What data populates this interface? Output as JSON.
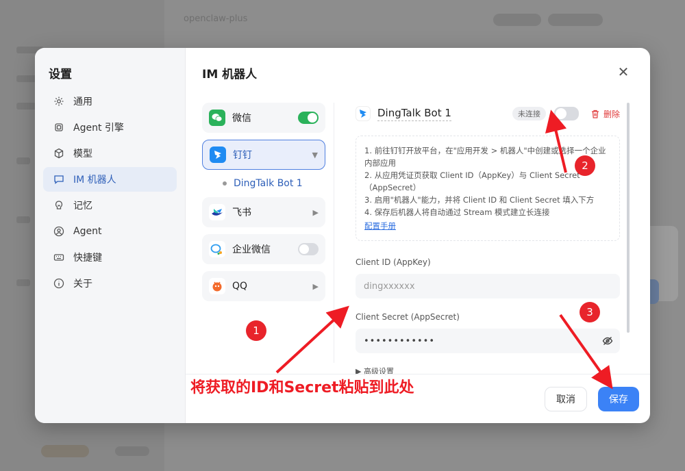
{
  "background": {
    "title": "openclaw-plus"
  },
  "nav": {
    "title": "设置",
    "items": [
      {
        "label": "通用",
        "icon": "gear-icon"
      },
      {
        "label": "Agent 引擎",
        "icon": "chip-icon"
      },
      {
        "label": "模型",
        "icon": "cube-icon"
      },
      {
        "label": "IM 机器人",
        "icon": "chat-icon",
        "active": true
      },
      {
        "label": "记忆",
        "icon": "memory-icon"
      },
      {
        "label": "Agent",
        "icon": "user-icon"
      },
      {
        "label": "快捷键",
        "icon": "keyboard-icon"
      },
      {
        "label": "关于",
        "icon": "info-icon"
      }
    ]
  },
  "main": {
    "title": "IM 机器人"
  },
  "platforms": [
    {
      "label": "微信",
      "control": "toggle-on",
      "color": "#2bb25b"
    },
    {
      "label": "钉钉",
      "control": "caret-down",
      "color": "#1f8bf2",
      "selected": true
    },
    {
      "label": "飞书",
      "control": "caret-right",
      "color": "#1f8bf2"
    },
    {
      "label": "企业微信",
      "control": "toggle-off",
      "color": "#2f9df0"
    },
    {
      "label": "QQ",
      "control": "caret-right",
      "color": "#f36b2c"
    }
  ],
  "sub_bot": {
    "label": "DingTalk Bot 1"
  },
  "bot": {
    "name": "DingTalk Bot 1",
    "status": "未连接",
    "delete_label": "删除",
    "enabled": false
  },
  "guide": {
    "steps": [
      "1. 前往钉钉开放平台，在\"应用开发 > 机器人\"中创建或选择一个企业内部应用",
      "2. 从应用凭证页获取 Client ID（AppKey）与 Client Secret（AppSecret）",
      "3. 启用\"机器人\"能力，并将 Client ID 和 Client Secret 填入下方",
      "4. 保存后机器人将自动通过 Stream 模式建立长连接"
    ],
    "link": "配置手册"
  },
  "fields": {
    "client_id_label": "Client ID (AppKey)",
    "client_id_placeholder": "dingxxxxxx",
    "client_secret_label": "Client Secret (AppSecret)",
    "client_secret_value": "••••••••••••"
  },
  "advanced_label": "高级设置",
  "footer": {
    "cancel": "取消",
    "save": "保存"
  },
  "annotations": {
    "n1": "1",
    "n2": "2",
    "n3": "3",
    "text": "将获取的ID和Secret粘贴到此处",
    "color": "#ee1c24"
  }
}
